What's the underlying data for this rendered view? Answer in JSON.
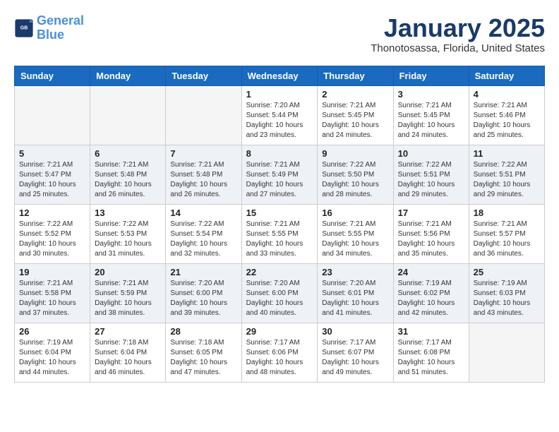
{
  "logo": {
    "line1": "General",
    "line2": "Blue"
  },
  "title": "January 2025",
  "subtitle": "Thonotosassa, Florida, United States",
  "days_of_week": [
    "Sunday",
    "Monday",
    "Tuesday",
    "Wednesday",
    "Thursday",
    "Friday",
    "Saturday"
  ],
  "weeks": [
    [
      {
        "day": "",
        "info": ""
      },
      {
        "day": "",
        "info": ""
      },
      {
        "day": "",
        "info": ""
      },
      {
        "day": "1",
        "info": "Sunrise: 7:20 AM\nSunset: 5:44 PM\nDaylight: 10 hours\nand 23 minutes."
      },
      {
        "day": "2",
        "info": "Sunrise: 7:21 AM\nSunset: 5:45 PM\nDaylight: 10 hours\nand 24 minutes."
      },
      {
        "day": "3",
        "info": "Sunrise: 7:21 AM\nSunset: 5:45 PM\nDaylight: 10 hours\nand 24 minutes."
      },
      {
        "day": "4",
        "info": "Sunrise: 7:21 AM\nSunset: 5:46 PM\nDaylight: 10 hours\nand 25 minutes."
      }
    ],
    [
      {
        "day": "5",
        "info": "Sunrise: 7:21 AM\nSunset: 5:47 PM\nDaylight: 10 hours\nand 25 minutes."
      },
      {
        "day": "6",
        "info": "Sunrise: 7:21 AM\nSunset: 5:48 PM\nDaylight: 10 hours\nand 26 minutes."
      },
      {
        "day": "7",
        "info": "Sunrise: 7:21 AM\nSunset: 5:48 PM\nDaylight: 10 hours\nand 26 minutes."
      },
      {
        "day": "8",
        "info": "Sunrise: 7:21 AM\nSunset: 5:49 PM\nDaylight: 10 hours\nand 27 minutes."
      },
      {
        "day": "9",
        "info": "Sunrise: 7:22 AM\nSunset: 5:50 PM\nDaylight: 10 hours\nand 28 minutes."
      },
      {
        "day": "10",
        "info": "Sunrise: 7:22 AM\nSunset: 5:51 PM\nDaylight: 10 hours\nand 29 minutes."
      },
      {
        "day": "11",
        "info": "Sunrise: 7:22 AM\nSunset: 5:51 PM\nDaylight: 10 hours\nand 29 minutes."
      }
    ],
    [
      {
        "day": "12",
        "info": "Sunrise: 7:22 AM\nSunset: 5:52 PM\nDaylight: 10 hours\nand 30 minutes."
      },
      {
        "day": "13",
        "info": "Sunrise: 7:22 AM\nSunset: 5:53 PM\nDaylight: 10 hours\nand 31 minutes."
      },
      {
        "day": "14",
        "info": "Sunrise: 7:22 AM\nSunset: 5:54 PM\nDaylight: 10 hours\nand 32 minutes."
      },
      {
        "day": "15",
        "info": "Sunrise: 7:21 AM\nSunset: 5:55 PM\nDaylight: 10 hours\nand 33 minutes."
      },
      {
        "day": "16",
        "info": "Sunrise: 7:21 AM\nSunset: 5:55 PM\nDaylight: 10 hours\nand 34 minutes."
      },
      {
        "day": "17",
        "info": "Sunrise: 7:21 AM\nSunset: 5:56 PM\nDaylight: 10 hours\nand 35 minutes."
      },
      {
        "day": "18",
        "info": "Sunrise: 7:21 AM\nSunset: 5:57 PM\nDaylight: 10 hours\nand 36 minutes."
      }
    ],
    [
      {
        "day": "19",
        "info": "Sunrise: 7:21 AM\nSunset: 5:58 PM\nDaylight: 10 hours\nand 37 minutes."
      },
      {
        "day": "20",
        "info": "Sunrise: 7:21 AM\nSunset: 5:59 PM\nDaylight: 10 hours\nand 38 minutes."
      },
      {
        "day": "21",
        "info": "Sunrise: 7:20 AM\nSunset: 6:00 PM\nDaylight: 10 hours\nand 39 minutes."
      },
      {
        "day": "22",
        "info": "Sunrise: 7:20 AM\nSunset: 6:00 PM\nDaylight: 10 hours\nand 40 minutes."
      },
      {
        "day": "23",
        "info": "Sunrise: 7:20 AM\nSunset: 6:01 PM\nDaylight: 10 hours\nand 41 minutes."
      },
      {
        "day": "24",
        "info": "Sunrise: 7:19 AM\nSunset: 6:02 PM\nDaylight: 10 hours\nand 42 minutes."
      },
      {
        "day": "25",
        "info": "Sunrise: 7:19 AM\nSunset: 6:03 PM\nDaylight: 10 hours\nand 43 minutes."
      }
    ],
    [
      {
        "day": "26",
        "info": "Sunrise: 7:19 AM\nSunset: 6:04 PM\nDaylight: 10 hours\nand 44 minutes."
      },
      {
        "day": "27",
        "info": "Sunrise: 7:18 AM\nSunset: 6:04 PM\nDaylight: 10 hours\nand 46 minutes."
      },
      {
        "day": "28",
        "info": "Sunrise: 7:18 AM\nSunset: 6:05 PM\nDaylight: 10 hours\nand 47 minutes."
      },
      {
        "day": "29",
        "info": "Sunrise: 7:17 AM\nSunset: 6:06 PM\nDaylight: 10 hours\nand 48 minutes."
      },
      {
        "day": "30",
        "info": "Sunrise: 7:17 AM\nSunset: 6:07 PM\nDaylight: 10 hours\nand 49 minutes."
      },
      {
        "day": "31",
        "info": "Sunrise: 7:17 AM\nSunset: 6:08 PM\nDaylight: 10 hours\nand 51 minutes."
      },
      {
        "day": "",
        "info": ""
      }
    ]
  ]
}
